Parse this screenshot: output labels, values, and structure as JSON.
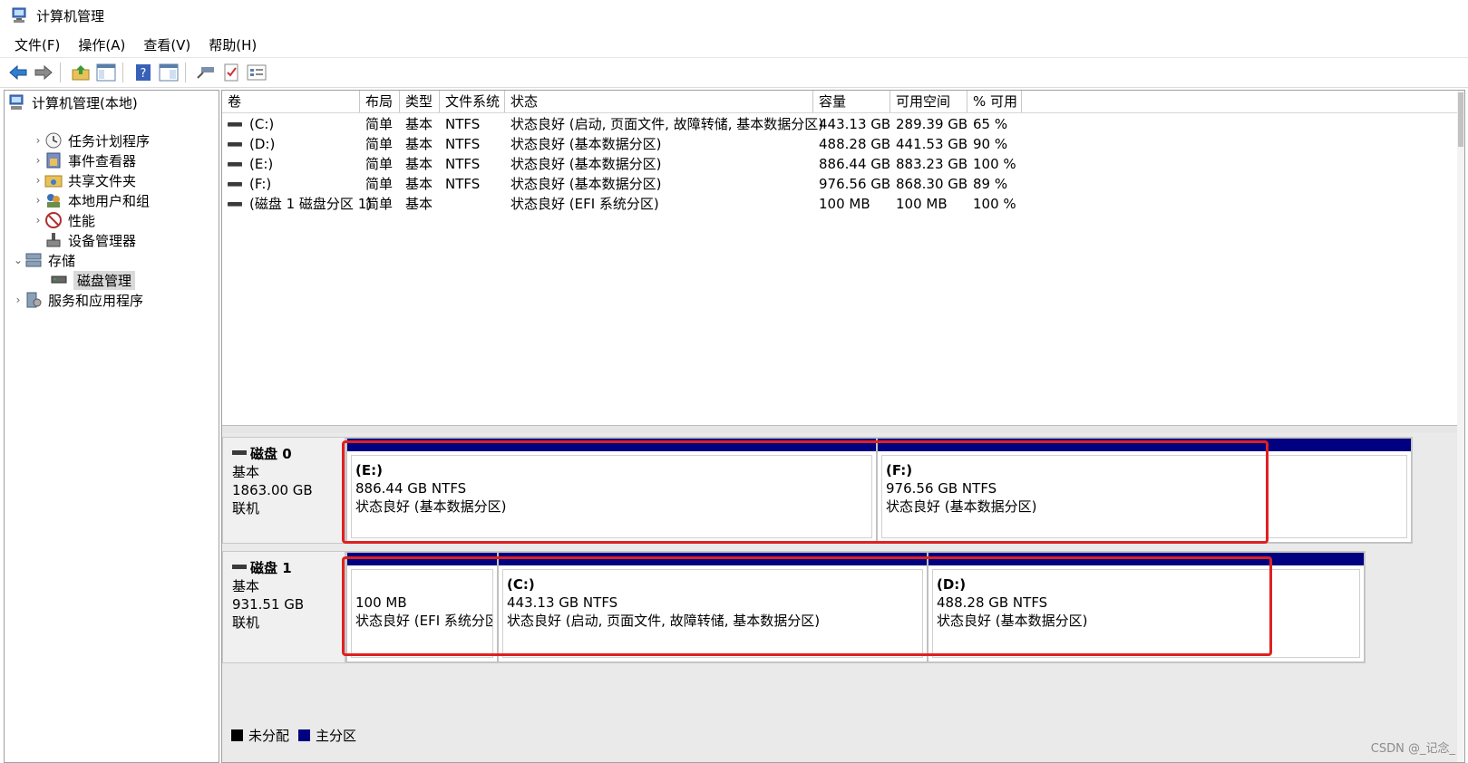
{
  "window": {
    "title": "计算机管理"
  },
  "menu": [
    "文件(F)",
    "操作(A)",
    "查看(V)",
    "帮助(H)"
  ],
  "toolbar_icons": [
    "back-arrow-icon",
    "forward-arrow-icon",
    "up-folder-icon",
    "show-hide-tree-icon",
    "help-icon",
    "properties-icon",
    "connect-icon",
    "checklist-icon",
    "list-view-icon"
  ],
  "tree": {
    "root": "计算机管理(本地)",
    "items": [
      {
        "label": "任务计划程序",
        "icon": "clock-icon"
      },
      {
        "label": "事件查看器",
        "icon": "event-viewer-icon"
      },
      {
        "label": "共享文件夹",
        "icon": "shared-folder-icon"
      },
      {
        "label": "本地用户和组",
        "icon": "users-icon"
      },
      {
        "label": "性能",
        "icon": "performance-icon"
      },
      {
        "label": "设备管理器",
        "icon": "device-manager-icon"
      }
    ],
    "storage": "存储",
    "disk_mgmt": "磁盘管理",
    "services": "服务和应用程序"
  },
  "volume_table": {
    "headers": [
      "卷",
      "布局",
      "类型",
      "文件系统",
      "状态",
      "容量",
      "可用空间",
      "% 可用"
    ],
    "rows": [
      [
        "(C:)",
        "简单",
        "基本",
        "NTFS",
        "状态良好 (启动, 页面文件, 故障转储, 基本数据分区)",
        "443.13 GB",
        "289.39 GB",
        "65 %"
      ],
      [
        "(D:)",
        "简单",
        "基本",
        "NTFS",
        "状态良好 (基本数据分区)",
        "488.28 GB",
        "441.53 GB",
        "90 %"
      ],
      [
        "(E:)",
        "简单",
        "基本",
        "NTFS",
        "状态良好 (基本数据分区)",
        "886.44 GB",
        "883.23 GB",
        "100 %"
      ],
      [
        "(F:)",
        "简单",
        "基本",
        "NTFS",
        "状态良好 (基本数据分区)",
        "976.56 GB",
        "868.30 GB",
        "89 %"
      ],
      [
        "(磁盘 1 磁盘分区 1)",
        "简单",
        "基本",
        "",
        "状态良好 (EFI 系统分区)",
        "100 MB",
        "100 MB",
        "100 %"
      ]
    ]
  },
  "disks": [
    {
      "name": "磁盘 0",
      "type": "基本",
      "size": "1863.00 GB",
      "status": "联机",
      "partitions": [
        {
          "name": "(E:)",
          "size": "886.44 GB NTFS",
          "status": "状态良好 (基本数据分区)"
        },
        {
          "name": "(F:)",
          "size": "976.56 GB NTFS",
          "status": "状态良好 (基本数据分区)"
        }
      ]
    },
    {
      "name": "磁盘 1",
      "type": "基本",
      "size": "931.51 GB",
      "status": "联机",
      "partitions": [
        {
          "name": "",
          "size": "100 MB",
          "status": "状态良好 (EFI 系统分区"
        },
        {
          "name": "(C:)",
          "size": "443.13 GB NTFS",
          "status": "状态良好 (启动, 页面文件, 故障转储, 基本数据分区)"
        },
        {
          "name": "(D:)",
          "size": "488.28 GB NTFS",
          "status": "状态良好 (基本数据分区)"
        }
      ]
    }
  ],
  "legend": [
    {
      "label": "未分配",
      "color": "#000000"
    },
    {
      "label": "主分区",
      "color": "#000080"
    }
  ],
  "watermark": "CSDN @_记念_",
  "colors": {
    "partition_bar": "#000080",
    "highlight": "#e02020"
  }
}
